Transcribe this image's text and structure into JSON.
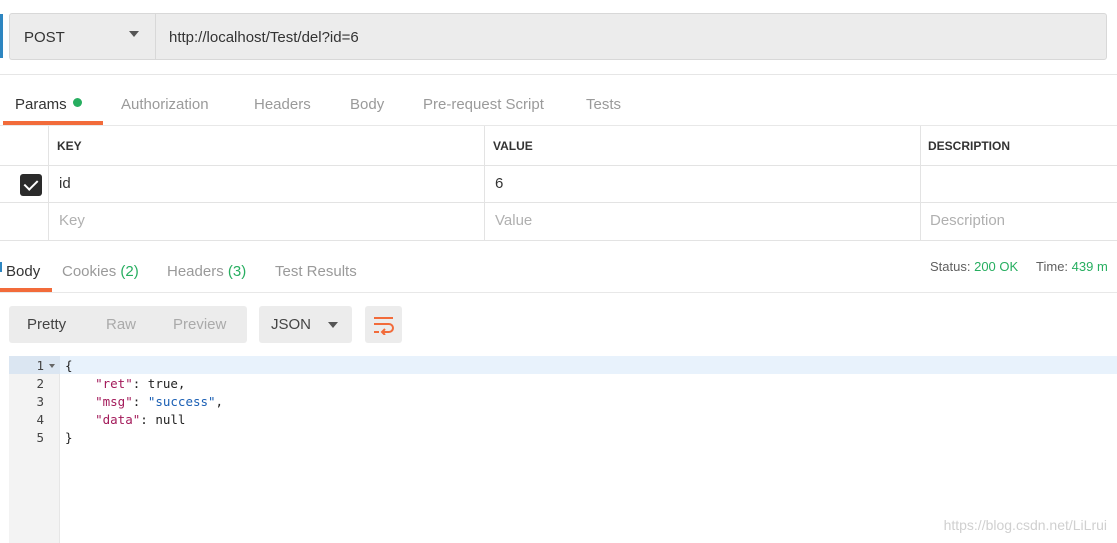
{
  "request": {
    "method": "POST",
    "url": "http://localhost/Test/del?id=6"
  },
  "request_tabs": [
    {
      "label": "Params",
      "active": true,
      "indicator_color": "#27ae60"
    },
    {
      "label": "Authorization"
    },
    {
      "label": "Headers"
    },
    {
      "label": "Body"
    },
    {
      "label": "Pre-request Script"
    },
    {
      "label": "Tests"
    }
  ],
  "params_table": {
    "headers": {
      "key": "KEY",
      "value": "VALUE",
      "description": "DESCRIPTION"
    },
    "rows": [
      {
        "checked": true,
        "key": "id",
        "value": "6",
        "description": ""
      }
    ],
    "placeholders": {
      "key": "Key",
      "value": "Value",
      "description": "Description"
    }
  },
  "response_tabs": {
    "body": "Body",
    "cookies": "Cookies",
    "cookies_count": "(2)",
    "headers": "Headers",
    "headers_count": "(3)",
    "test_results": "Test Results"
  },
  "status": {
    "status_label": "Status:",
    "status_value": "200 OK",
    "time_label": "Time:",
    "time_value": "439 m"
  },
  "view_modes": [
    "Pretty",
    "Raw",
    "Preview"
  ],
  "active_view": "Pretty",
  "format": "JSON",
  "code_lines": [
    {
      "num": "1",
      "tokens": [
        {
          "t": "{",
          "c": "plain"
        }
      ]
    },
    {
      "num": "2",
      "tokens": [
        {
          "t": "    ",
          "c": "plain"
        },
        {
          "t": "\"ret\"",
          "c": "key"
        },
        {
          "t": ": true,",
          "c": "plain"
        }
      ]
    },
    {
      "num": "3",
      "tokens": [
        {
          "t": "    ",
          "c": "plain"
        },
        {
          "t": "\"msg\"",
          "c": "key"
        },
        {
          "t": ": ",
          "c": "plain"
        },
        {
          "t": "\"success\"",
          "c": "str"
        },
        {
          "t": ",",
          "c": "plain"
        }
      ]
    },
    {
      "num": "4",
      "tokens": [
        {
          "t": "    ",
          "c": "plain"
        },
        {
          "t": "\"data\"",
          "c": "key"
        },
        {
          "t": ": null",
          "c": "plain"
        }
      ]
    },
    {
      "num": "5",
      "tokens": [
        {
          "t": "}",
          "c": "plain"
        }
      ]
    }
  ],
  "watermark": "https://blog.csdn.net/LiLrui",
  "colors": {
    "accent": "#f26b3a",
    "success": "#27ae60"
  }
}
